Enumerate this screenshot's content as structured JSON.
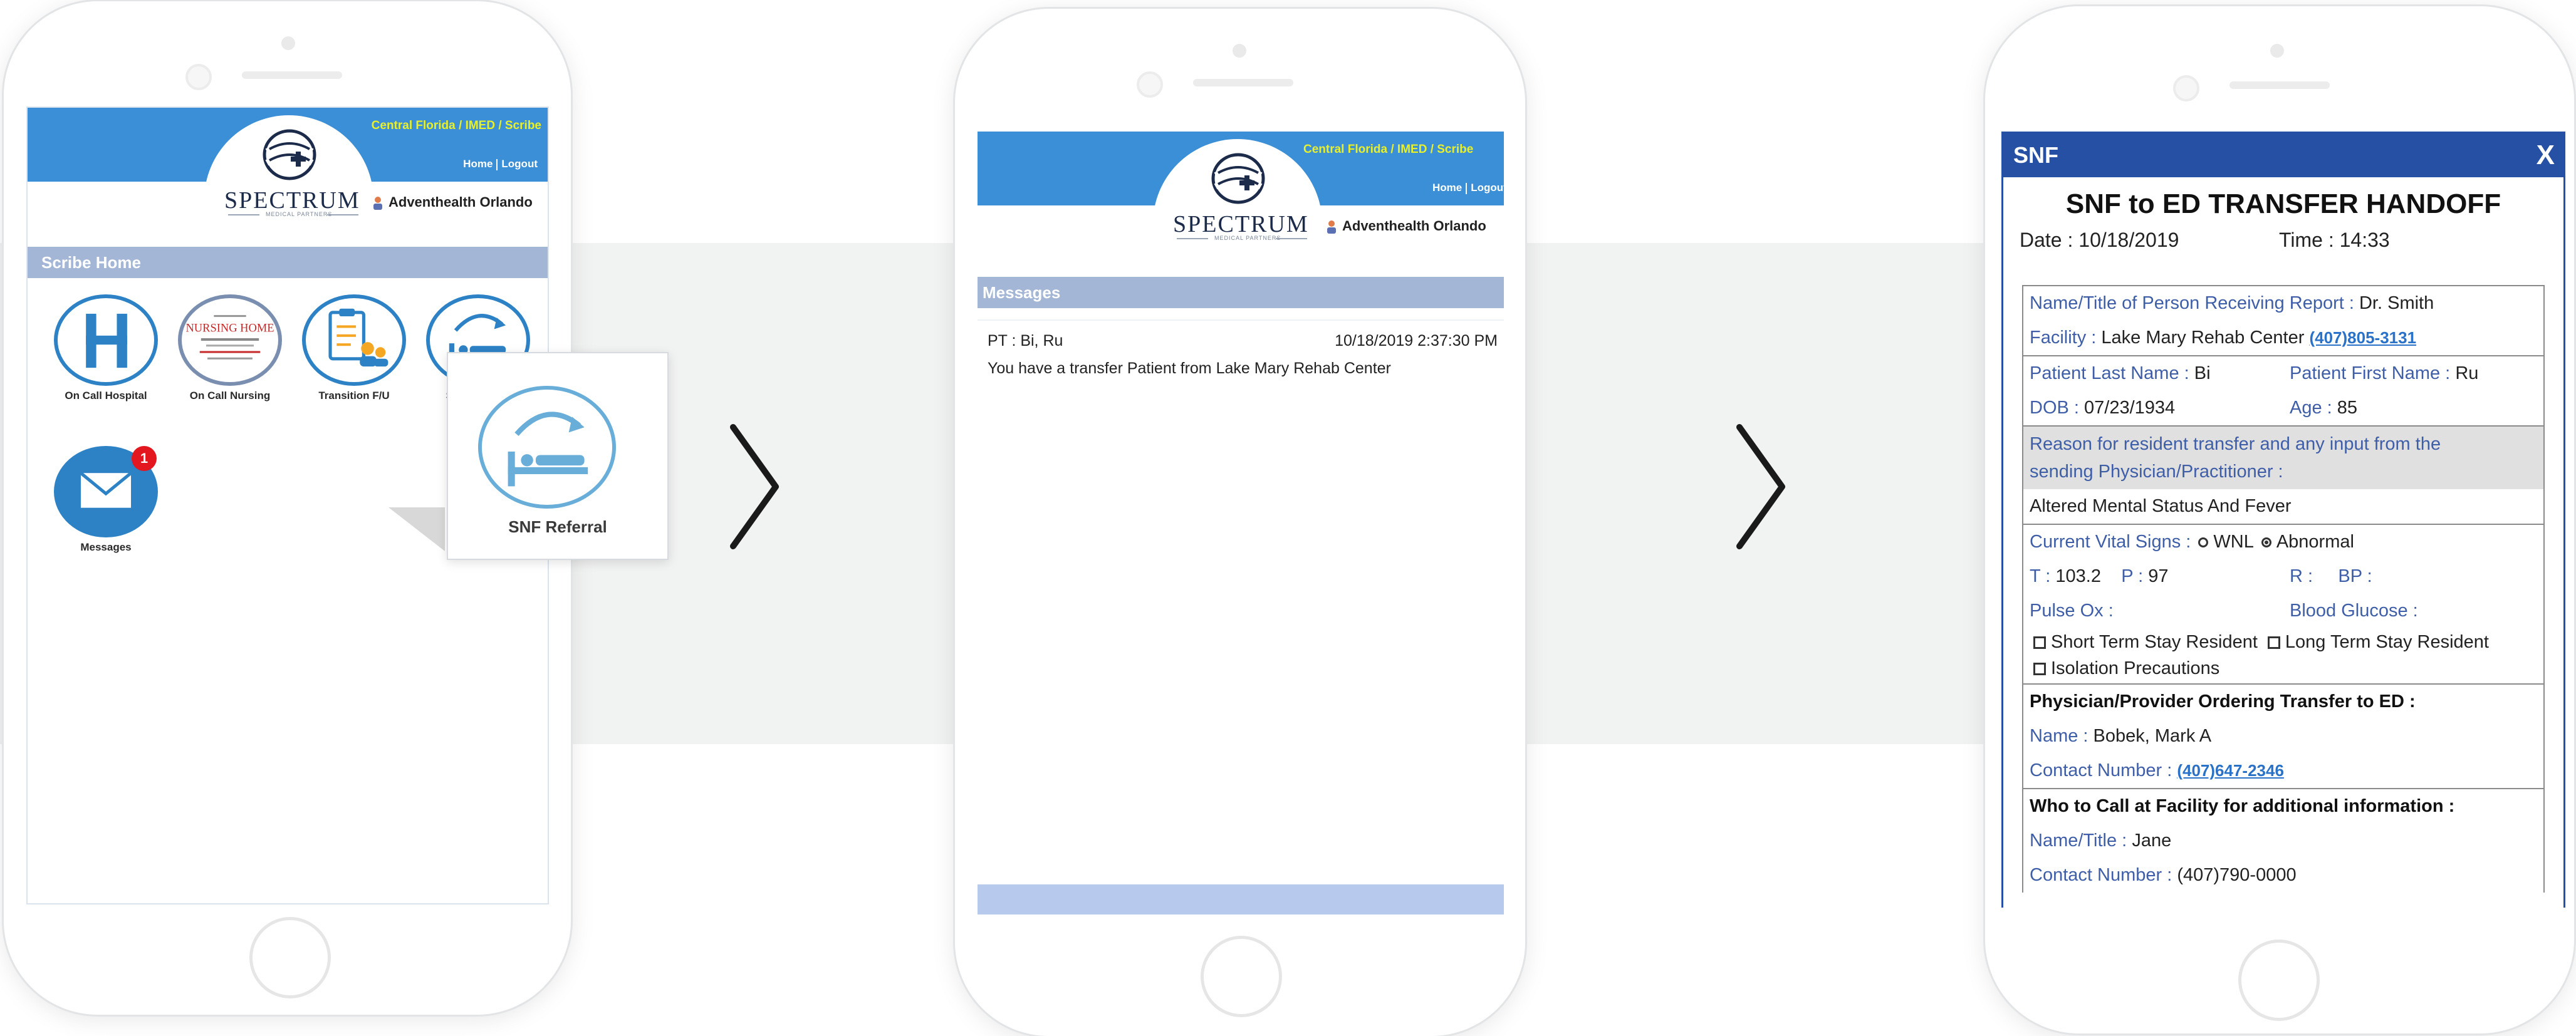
{
  "app": {
    "breadcrumb": "Central Florida / IMED / Scribe",
    "nav_home": "Home",
    "nav_logout": "Logout",
    "logo_text": "SPECTRUM",
    "logo_tagline": "MEDICAL PARTNERS",
    "user": "Adventhealth Orlando"
  },
  "screen1": {
    "section_title": "Scribe Home",
    "tiles": [
      {
        "label": "On Call Hospital",
        "icon": "hospital-h-icon"
      },
      {
        "label": "On Call Nursing",
        "icon": "nursing-home-icon"
      },
      {
        "label": "Transition F/U",
        "icon": "transition-clipboard-icon"
      },
      {
        "label": "SNF Referral",
        "icon": "bed-transfer-icon"
      },
      {
        "label": "Messages",
        "icon": "envelope-icon",
        "badge": "1"
      }
    ],
    "popup_label": "SNF Referral"
  },
  "screen2": {
    "section_title": "Messages",
    "message": {
      "patient": "PT : Bi, Ru",
      "timestamp": "10/18/2019 2:37:30 PM",
      "body": "You have a transfer Patient from Lake Mary Rehab Center"
    }
  },
  "screen3": {
    "header": "SNF",
    "close_glyph": "X",
    "title": "SNF to ED TRANSFER HANDOFF",
    "date_label": "Date :",
    "date": "10/18/2019",
    "time_label": "Time :",
    "time": "14:33",
    "receiver_label": "Name/Title of Person Receiving Report :",
    "receiver": "Dr. Smith",
    "facility_label": "Facility :",
    "facility": "Lake Mary Rehab Center",
    "facility_phone": "(407)805-3131",
    "last_name_label": "Patient Last Name :",
    "last_name": "Bi",
    "first_name_label": "Patient First Name :",
    "first_name": "Ru",
    "dob_label": "DOB :",
    "dob": "07/23/1934",
    "age_label": "Age :",
    "age": "85",
    "reason_label_1": "Reason for resident transfer and any input from the",
    "reason_label_2": "sending Physician/Practitioner :",
    "reason": "Altered Mental Status And Fever",
    "vitals_label": "Current Vital Signs :",
    "vitals_wnl": "WNL",
    "vitals_abnormal": "Abnormal",
    "vitals_selected": "Abnormal",
    "t_label": "T :",
    "t": "103.2",
    "p_label": "P :",
    "p": "97",
    "r_label": "R :",
    "bp_label": "BP :",
    "pulse_ox_label": "Pulse Ox :",
    "glucose_label": "Blood Glucose :",
    "short_stay": "Short Term Stay Resident",
    "long_stay": "Long Term Stay Resident",
    "isolation": "Isolation Precautions",
    "physician_heading": "Physician/Provider Ordering Transfer to ED :",
    "phys_name_label": "Name :",
    "phys_name": "Bobek, Mark A",
    "phys_contact_label": "Contact Number :",
    "phys_contact": "(407)647-2346",
    "who_heading": "Who to Call at Facility for additional information :",
    "fac_name_label": "Name/Title :",
    "fac_name": "Jane",
    "fac_contact_label": "Contact Number :",
    "fac_contact": "(407)790-0000"
  },
  "colors": {
    "header_blue": "#3b8fd6",
    "breadcrumb_yellow": "#e8ef2b",
    "section_bar": "#a3b6d6",
    "snf_header": "#2650a3",
    "badge_red": "#e3171f"
  }
}
